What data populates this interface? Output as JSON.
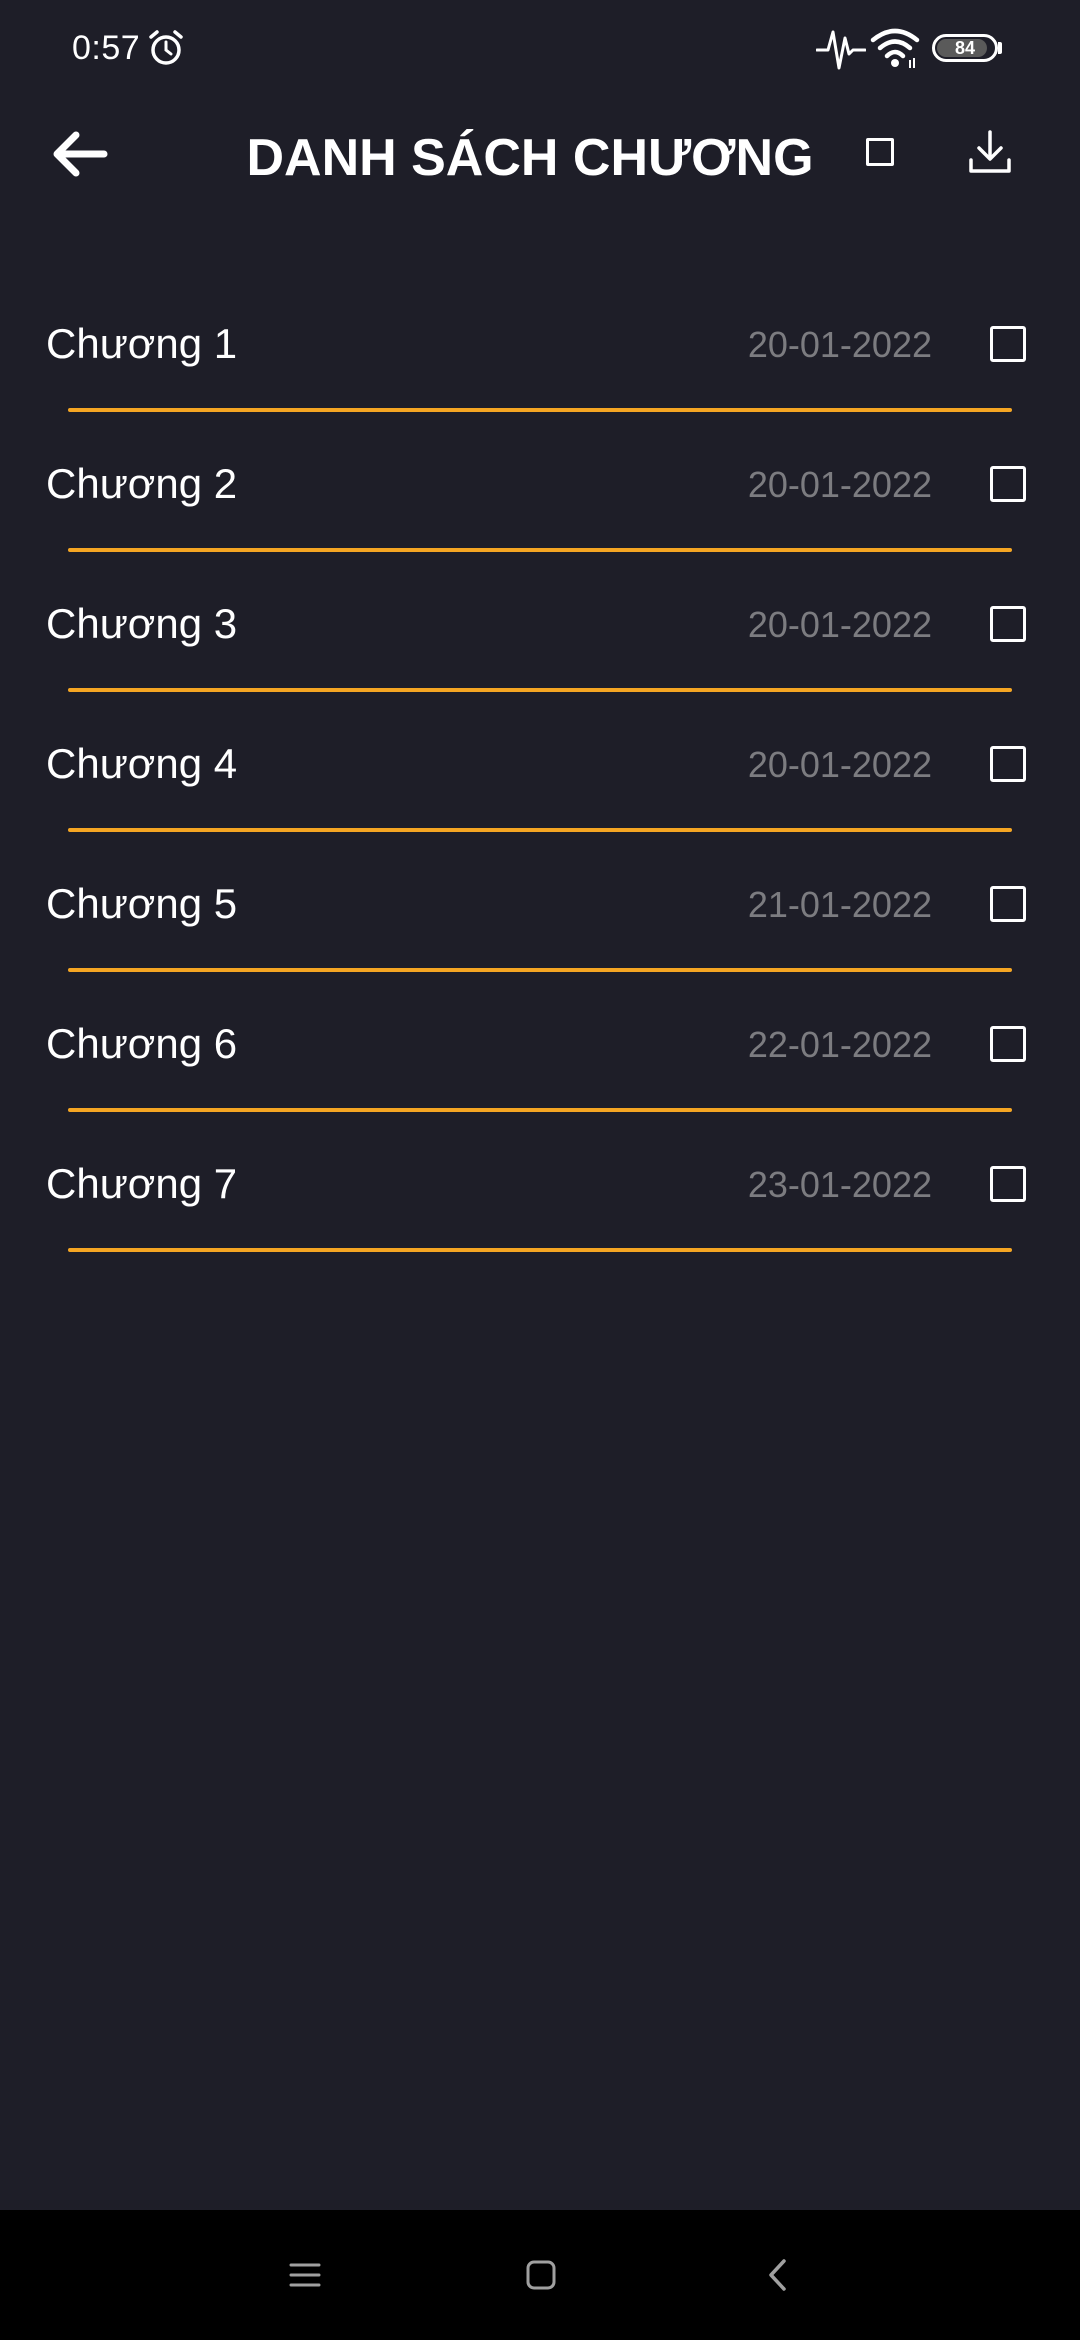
{
  "status_bar": {
    "time": "0:57",
    "battery_level": "84",
    "icons": [
      "alarm-icon",
      "heart-rate-icon",
      "wifi-icon",
      "battery-icon"
    ]
  },
  "app_bar": {
    "title": "DANH SÁCH CHƯƠNG",
    "icons": [
      "back-arrow-icon",
      "select-all-checkbox-icon",
      "download-icon"
    ]
  },
  "chapters": [
    {
      "name": "Chương 1",
      "date": "20-01-2022"
    },
    {
      "name": "Chương 2",
      "date": "20-01-2022"
    },
    {
      "name": "Chương 3",
      "date": "20-01-2022"
    },
    {
      "name": "Chương 4",
      "date": "20-01-2022"
    },
    {
      "name": "Chương 5",
      "date": "21-01-2022"
    },
    {
      "name": "Chương 6",
      "date": "22-01-2022"
    },
    {
      "name": "Chương 7",
      "date": "23-01-2022"
    }
  ],
  "nav_bar": {
    "icons": [
      "menu-icon",
      "home-icon",
      "back-icon"
    ]
  },
  "colors": {
    "background": "#1e1e28",
    "accent": "#f5a623",
    "date_text": "#7c7c80",
    "nav_bar": "#000000"
  }
}
